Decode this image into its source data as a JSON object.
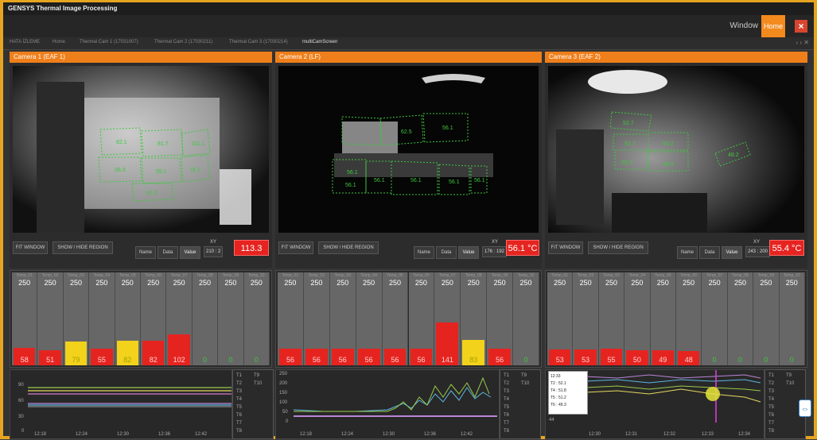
{
  "app": {
    "title": "GENSYS Thermal Image Processing"
  },
  "menu": {
    "window": "Window",
    "home": "Home",
    "close": "×"
  },
  "tabs": [
    "HATA İZLEME",
    "Home",
    "Thermal Cam 1 (17031007)",
    "Thermal Cam 2 (17030211)",
    "Thermal Cam 3 (17030214)",
    "multiCamScreen"
  ],
  "tab_controls": "‹ › ✕",
  "cameras": [
    {
      "title": "Camera 1 (EAF 1)",
      "xy_label": "XY",
      "xy_value": "210 : 2",
      "temp": "113.3",
      "regions": [
        "82.1",
        "81.7",
        "101.1",
        "58.3",
        "55.1",
        "79.1",
        "51.3"
      ]
    },
    {
      "title": "Camera 2 (LF)",
      "xy_label": "XY",
      "xy_value": "176 : 192",
      "temp": "56.1 °C",
      "regions": [
        "62.5",
        "56.1",
        "56.1",
        "56.1",
        "56.1",
        "56.1",
        "56.1",
        "56.1"
      ]
    },
    {
      "title": "Camera 3 (EAF 2)",
      "xy_label": "XY",
      "xy_value": "243 : 200",
      "temp": "55.4 °C",
      "regions": [
        "52.7",
        "52.7",
        "50.2",
        "55.2",
        "49.5",
        "48.2"
      ]
    }
  ],
  "controls": {
    "fit": "FIT WINDOW",
    "show_hide": "SHOW / HIDE REGION",
    "name": "Name",
    "data": "Data",
    "value": "Value"
  },
  "bar_columns": [
    "Temp_01",
    "Temp_02",
    "Temp_03",
    "Temp_04",
    "Temp_05",
    "Temp_06",
    "Temp_07",
    "Temp_08",
    "Temp_09",
    "Temp_10"
  ],
  "bar_max": "250",
  "bar_groups": [
    {
      "values": [
        58,
        51,
        79,
        55,
        82,
        82,
        102,
        0,
        0,
        0
      ],
      "colors": [
        "red",
        "red",
        "yellow",
        "red",
        "yellow",
        "red",
        "red",
        "none",
        "none",
        "none"
      ]
    },
    {
      "values": [
        56,
        56,
        56,
        56,
        56,
        56,
        141,
        83,
        56,
        0
      ],
      "colors": [
        "red",
        "red",
        "red",
        "red",
        "red",
        "red",
        "red",
        "yellow",
        "red",
        "none"
      ]
    },
    {
      "values": [
        53,
        53,
        55,
        50,
        49,
        48,
        0,
        0,
        0,
        0
      ],
      "colors": [
        "red",
        "red",
        "red",
        "red",
        "red",
        "red",
        "none",
        "none",
        "none",
        "none"
      ]
    }
  ],
  "colors": {
    "red": "#e52420",
    "yellow": "#f2d21b",
    "accent": "#ef7f1a"
  },
  "trends": [
    {
      "yticks": [
        "90",
        "60",
        "30",
        "0"
      ],
      "xticks": [
        "12:18",
        "12:24",
        "12:30",
        "12:36",
        "12:42"
      ]
    },
    {
      "yticks": [
        "250",
        "200",
        "150",
        "100",
        "50",
        "0"
      ],
      "xticks": [
        "12:18",
        "12:24",
        "12:30",
        "12:36",
        "12:42"
      ]
    },
    {
      "yticks": [
        "44"
      ],
      "xticks": [
        "12:30",
        "12:31",
        "12:32",
        "12:33",
        "12:34"
      ]
    }
  ],
  "legend": [
    "T1",
    "T9",
    "T2",
    "T10",
    "T3",
    "T4",
    "T5",
    "T6",
    "T7",
    "T8"
  ],
  "tooltip": {
    "time": "12:33",
    "rows": [
      "T2 : 52.1",
      "T4 : 51.8",
      "T5 : 51.2",
      "T6 : 49.3"
    ]
  }
}
